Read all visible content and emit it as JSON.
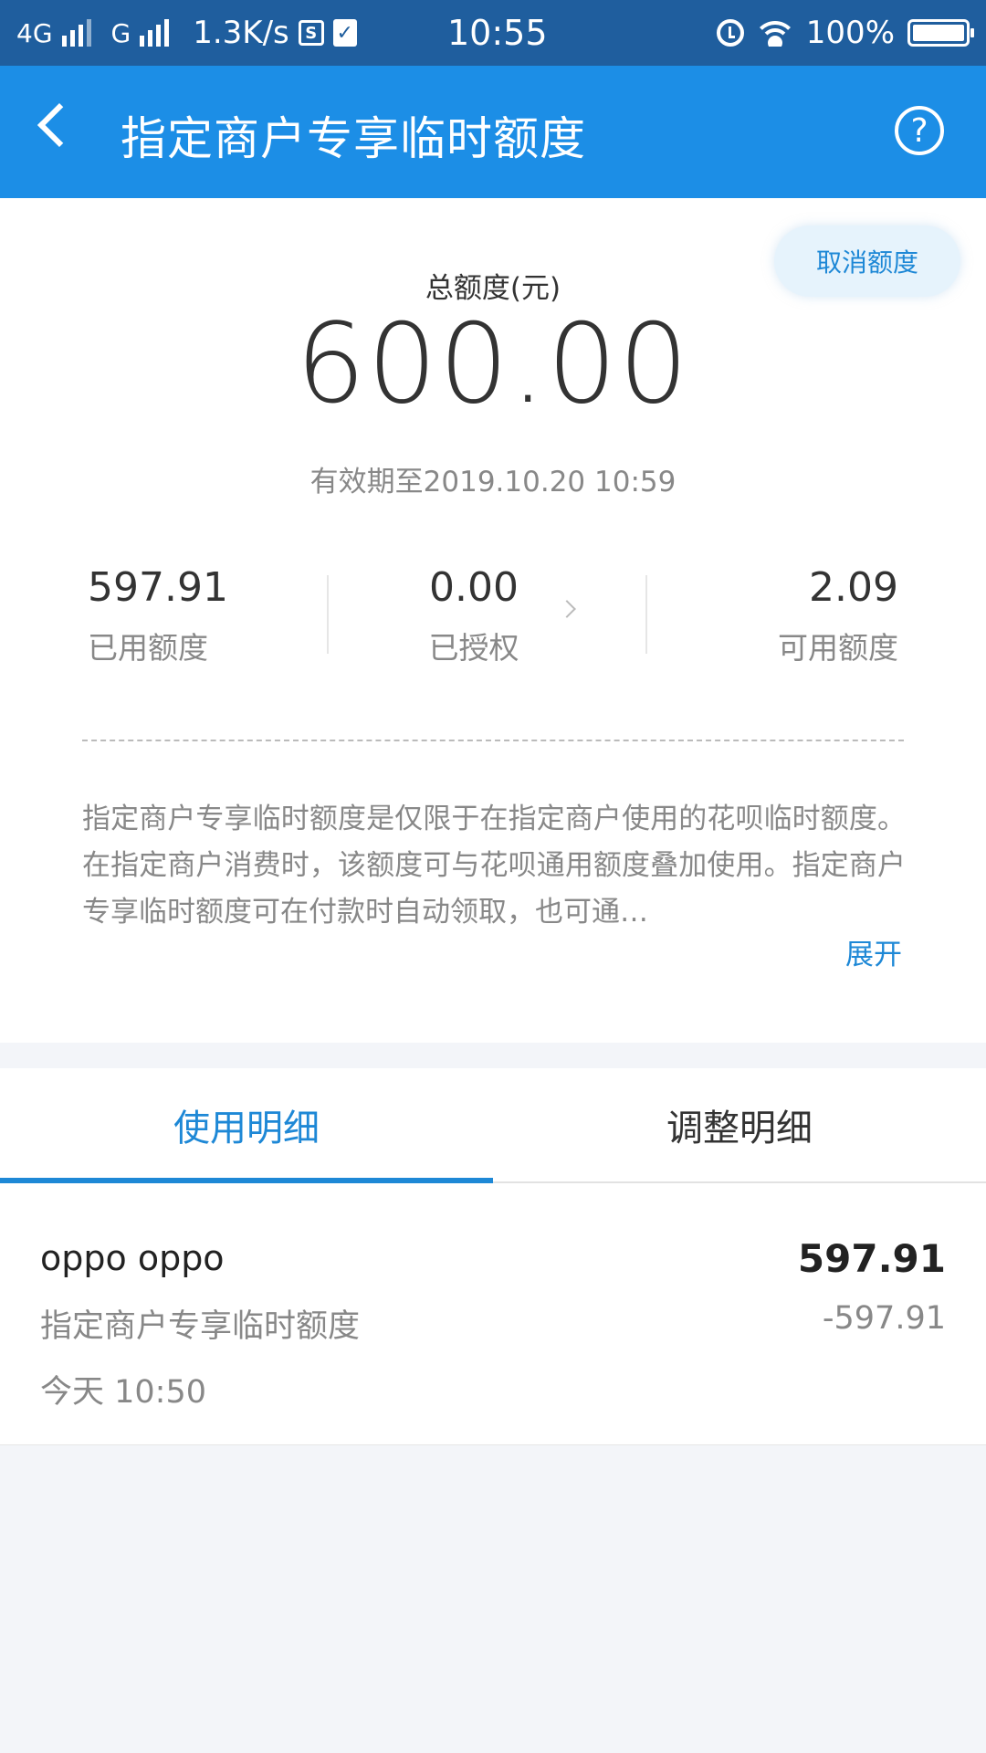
{
  "status_bar": {
    "network1": "4G",
    "network2": "G",
    "speed": "1.3K/s",
    "icon_s": "S",
    "time": "10:55",
    "battery": "100%"
  },
  "nav": {
    "title": "指定商户专享临时额度",
    "help": "?"
  },
  "summary": {
    "cancel_button": "取消额度",
    "total_label": "总额度(元)",
    "total_amount": "600.00",
    "expiry": "有效期至2019.10.20 10:59",
    "stats": [
      {
        "value": "597.91",
        "label": "已用额度"
      },
      {
        "value": "0.00",
        "label": "已授权"
      },
      {
        "value": "2.09",
        "label": "可用额度"
      }
    ],
    "description": "指定商户专享临时额度是仅限于在指定商户使用的花呗临时额度。在指定商户消费时，该额度可与花呗通用额度叠加使用。指定商户专享临时额度可在付款时自动领取，也可通…",
    "expand": "展开"
  },
  "tabs": [
    {
      "label": "使用明细",
      "active": true
    },
    {
      "label": "调整明细",
      "active": false
    }
  ],
  "records": [
    {
      "merchant": "oppo oppo",
      "type": "指定商户专享临时额度",
      "time": "今天 10:50",
      "amount": "597.91",
      "delta": "-597.91"
    }
  ],
  "colors": {
    "nav_bg": "#1c8ee6",
    "status_bg": "#1f5e9e",
    "accent": "#1e88d6"
  }
}
